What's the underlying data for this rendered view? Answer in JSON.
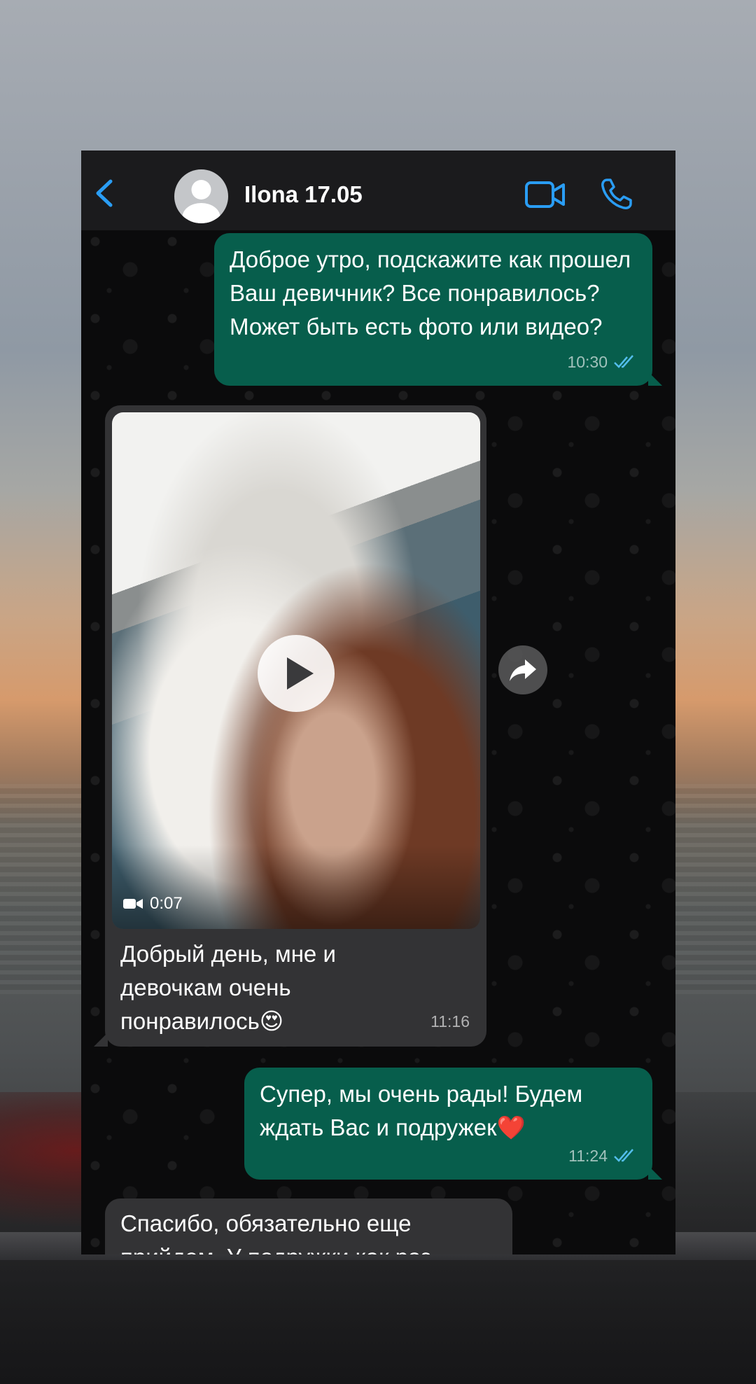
{
  "header": {
    "contact_name": "Ilona 17.05"
  },
  "icons": {
    "back": "chevron-left-icon",
    "avatar": "default-avatar-icon",
    "video_call": "video-camera-icon",
    "voice_call": "phone-icon",
    "read_receipt": "double-check-icon",
    "play": "play-icon",
    "forward": "forward-share-icon"
  },
  "colors": {
    "accent": "#2a9df4",
    "outgoing_bubble": "#075e4c",
    "incoming_bubble": "#333335",
    "read_tick": "#53bdeb"
  },
  "messages": [
    {
      "direction": "out",
      "text": "Доброе утро, подскажите как прошел Ваш девичник? Все понравилось? Может быть есть фото или видео?",
      "time": "10:30",
      "status": "read"
    },
    {
      "direction": "in",
      "type": "video",
      "video_duration": "0:07",
      "caption": "Добрый день, мне и девочкам очень понравилось😍",
      "time": "11:16"
    },
    {
      "direction": "out",
      "text": "Супер, мы очень рады! Будем ждать Вас и подружек❤️",
      "time": "11:24",
      "status": "read"
    },
    {
      "direction": "in",
      "text": "Спасибо, обязательно еще прийдем. У подружки как раз",
      "partial": true
    }
  ]
}
